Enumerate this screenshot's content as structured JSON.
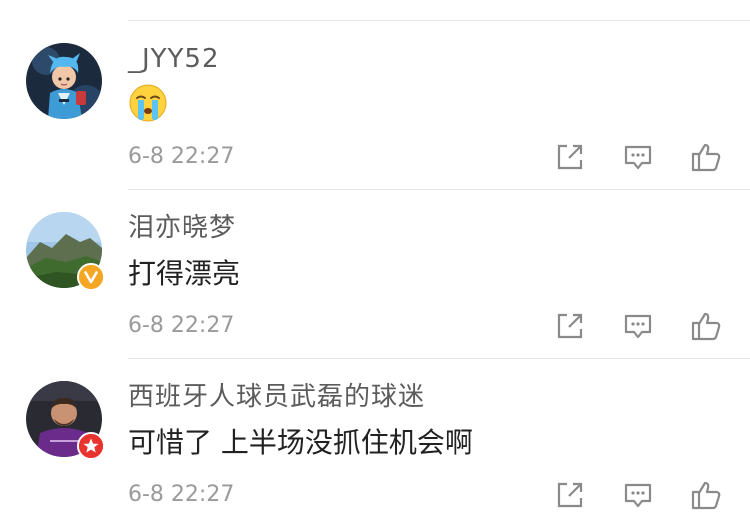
{
  "comments": [
    {
      "username": "_JYY52",
      "content_emoji": "crying-face",
      "time": "6-8 22:27",
      "verified": false,
      "avatar_icon": "avatar-cartoon-character"
    },
    {
      "username": "泪亦晓梦",
      "content": "打得漂亮",
      "time": "6-8 22:27",
      "verified": true,
      "badge_color": "#f5a623",
      "avatar_icon": "avatar-mountain-landscape"
    },
    {
      "username": "西班牙人球员武磊的球迷",
      "content": "可惜了 上半场没抓住机会啊",
      "time": "6-8 22:27",
      "verified": true,
      "badge_color": "#e8332e",
      "avatar_icon": "avatar-football-player"
    }
  ],
  "action_icons": [
    "share-icon",
    "reply-icon",
    "like-icon"
  ],
  "colors": {
    "username": "#5c5c5c",
    "content": "#222222",
    "timestamp": "#9a9a9a",
    "icon": "#8a8a8a",
    "divider": "#e8e8e8"
  }
}
